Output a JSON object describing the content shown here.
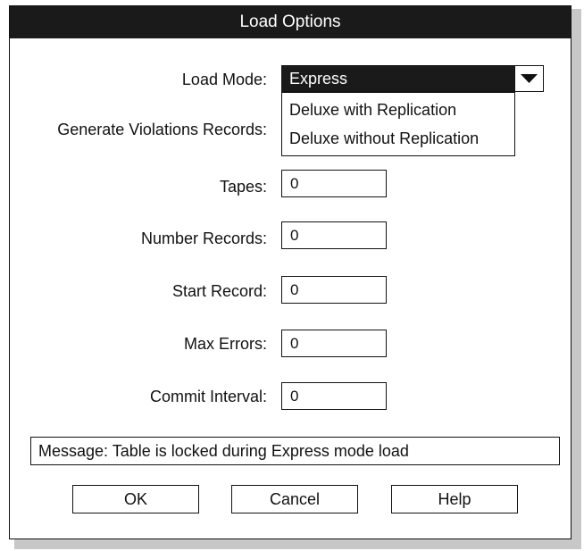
{
  "dialog": {
    "title": "Load Options"
  },
  "form": {
    "load_mode": {
      "label": "Load Mode:",
      "value": "Express",
      "options": [
        "Deluxe with Replication",
        "Deluxe without Replication"
      ]
    },
    "violations": {
      "label": "Generate Violations Records:"
    },
    "tapes": {
      "label": "Tapes:",
      "value": "0"
    },
    "number_records": {
      "label": "Number Records:",
      "value": "0"
    },
    "start_record": {
      "label": "Start Record:",
      "value": "0"
    },
    "max_errors": {
      "label": "Max Errors:",
      "value": "0"
    },
    "commit_interval": {
      "label": "Commit Interval:",
      "value": "0"
    }
  },
  "message": "Message: Table is locked during Express mode load",
  "buttons": {
    "ok": "OK",
    "cancel": "Cancel",
    "help": "Help"
  },
  "colors": {
    "titlebar_bg": "#1a1a1a",
    "selected_bg": "#1a1a1a",
    "shadow": "#c8c8c8"
  },
  "icons": {
    "combo_arrow": "triangle-down-icon"
  }
}
